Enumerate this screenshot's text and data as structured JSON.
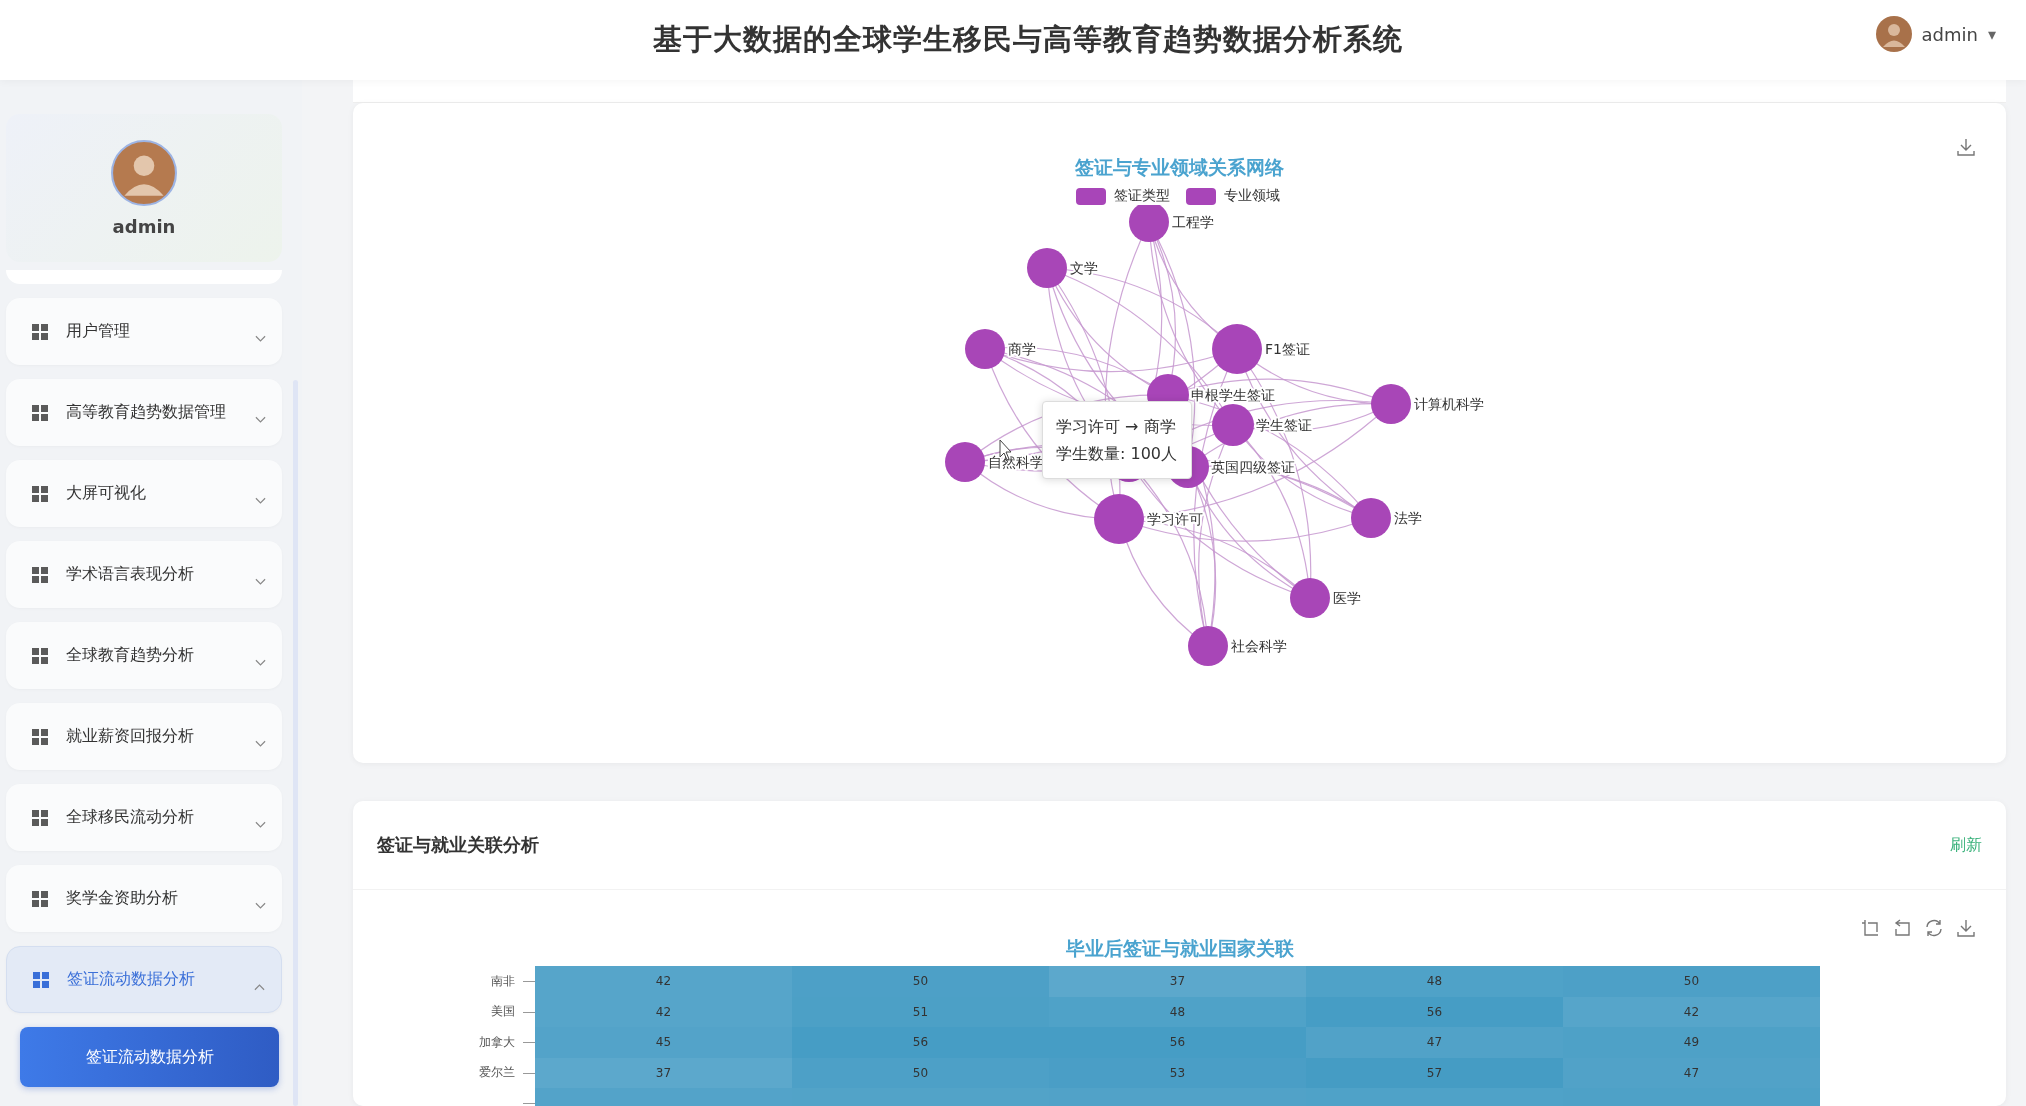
{
  "header": {
    "title": "基于大数据的全球学生移民与高等教育趋势数据分析系统",
    "user": "admin",
    "caret": "▾"
  },
  "sidebar": {
    "profile_name": "admin",
    "items": [
      {
        "label": "用户管理",
        "expanded": false,
        "selected": false
      },
      {
        "label": "高等教育趋势数据管理",
        "expanded": false,
        "selected": false
      },
      {
        "label": "大屏可视化",
        "expanded": false,
        "selected": false
      },
      {
        "label": "学术语言表现分析",
        "expanded": false,
        "selected": false
      },
      {
        "label": "全球教育趋势分析",
        "expanded": false,
        "selected": false
      },
      {
        "label": "就业薪资回报分析",
        "expanded": false,
        "selected": false
      },
      {
        "label": "全球移民流动分析",
        "expanded": false,
        "selected": false
      },
      {
        "label": "奖学金资助分析",
        "expanded": false,
        "selected": false
      },
      {
        "label": "签证流动数据分析",
        "expanded": true,
        "selected": true
      }
    ],
    "subitems": [
      {
        "label": "签证流动数据分析",
        "selected": true
      }
    ]
  },
  "network_card": {
    "title": "签证与专业领域关系网络",
    "legend": [
      {
        "label": "签证类型",
        "color": "#a845b8"
      },
      {
        "label": "专业领域",
        "color": "#a845b8"
      }
    ],
    "nodes": [
      {
        "label": "工程学",
        "kind": "major"
      },
      {
        "label": "文学",
        "kind": "major"
      },
      {
        "label": "商学",
        "kind": "major"
      },
      {
        "label": "F1签证",
        "kind": "visa"
      },
      {
        "label": "申根学生签证",
        "kind": "visa"
      },
      {
        "label": "学生签证",
        "kind": "visa"
      },
      {
        "label": "计算机科学",
        "kind": "major"
      },
      {
        "label": "自然科学",
        "kind": "major"
      },
      {
        "label": "英国四级签证",
        "kind": "visa"
      },
      {
        "label": "学习许可",
        "kind": "visa"
      },
      {
        "label": "法学",
        "kind": "major"
      },
      {
        "label": "医学",
        "kind": "major"
      },
      {
        "label": "社会科学",
        "kind": "major"
      }
    ],
    "tooltip": {
      "lines": [
        "学习许可 → 商学",
        "学生数量: 100人"
      ]
    }
  },
  "employment_card": {
    "title": "签证与就业关联分析",
    "refresh": "刷新",
    "chart_title": "毕业后签证与就业国家关联",
    "rows": [
      {
        "label": "南非",
        "values": [
          "42",
          "50",
          "37",
          "48",
          "50"
        ]
      },
      {
        "label": "美国",
        "values": [
          "42",
          "51",
          "48",
          "56",
          "42"
        ]
      },
      {
        "label": "加拿大",
        "values": [
          "45",
          "56",
          "56",
          "47",
          "49"
        ]
      },
      {
        "label": "爱尔兰",
        "values": [
          "37",
          "50",
          "53",
          "57",
          "47"
        ]
      }
    ]
  }
}
